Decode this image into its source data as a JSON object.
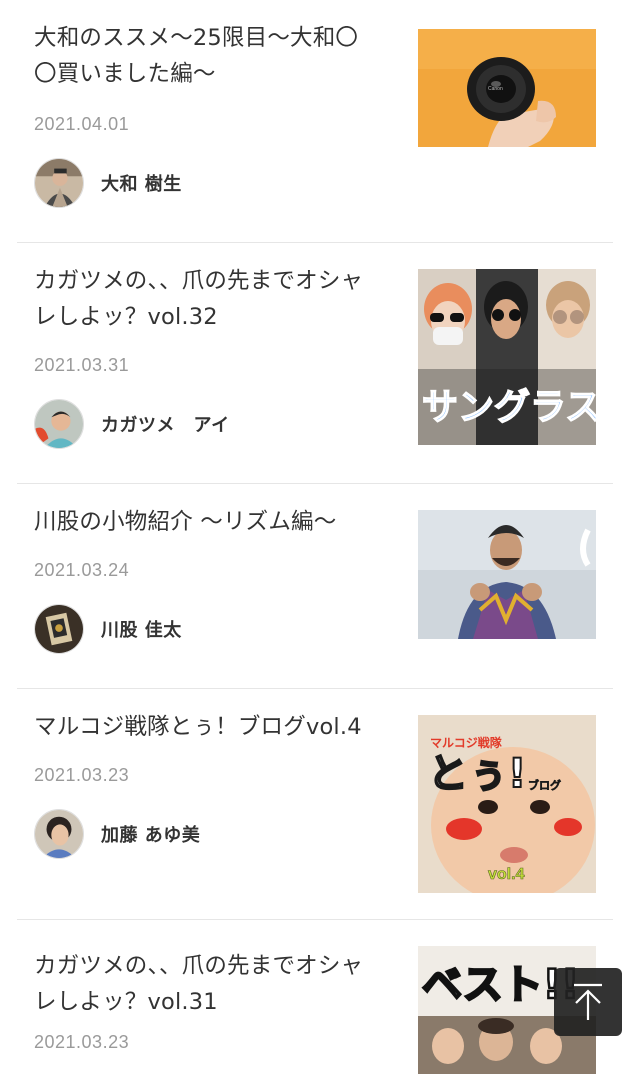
{
  "articles": [
    {
      "title": "大和のススメ〜25限目〜大和〇〇買いました編〜",
      "date": "2021.04.01",
      "author": "大和 樹生",
      "thumbnail_icon": "camera-lens-photo",
      "avatar_icon": "person-photo"
    },
    {
      "title": "カガツメの、、爪の先までオシャレしよッ？vol.32",
      "date": "2021.03.31",
      "author": "カガツメ　アイ",
      "thumbnail_icon": "sunglasses-photo",
      "thumbnail_caption": "サングラス",
      "avatar_icon": "person-photo"
    },
    {
      "title": "川股の小物紹介 〜リズム編〜",
      "date": "2021.03.24",
      "author": "川股 佳太",
      "thumbnail_icon": "man-in-plaid-photo",
      "avatar_icon": "person-photo"
    },
    {
      "title": "マルコジ戦隊とぅ！ブログvol.4",
      "date": "2021.03.23",
      "author": "加藤 あゆ美",
      "thumbnail_icon": "baby-poster-photo",
      "thumbnail_caption": {
        "top": "マルコジ戦隊",
        "main": "とぅ!",
        "sub": "ブログ",
        "vol": "vol.4"
      },
      "avatar_icon": "person-photo"
    },
    {
      "title": "カガツメの、、爪の先までオシャレしよッ？vol.31",
      "date": "2021.03.23",
      "thumbnail_icon": "best-group-photo",
      "thumbnail_caption": "ベスト!!"
    }
  ],
  "back_to_top": {
    "icon": "arrow-up-icon"
  },
  "colors": {
    "text": "#333333",
    "date": "#9a9a9a",
    "divider": "#e6e6e6",
    "button": "#222222"
  }
}
